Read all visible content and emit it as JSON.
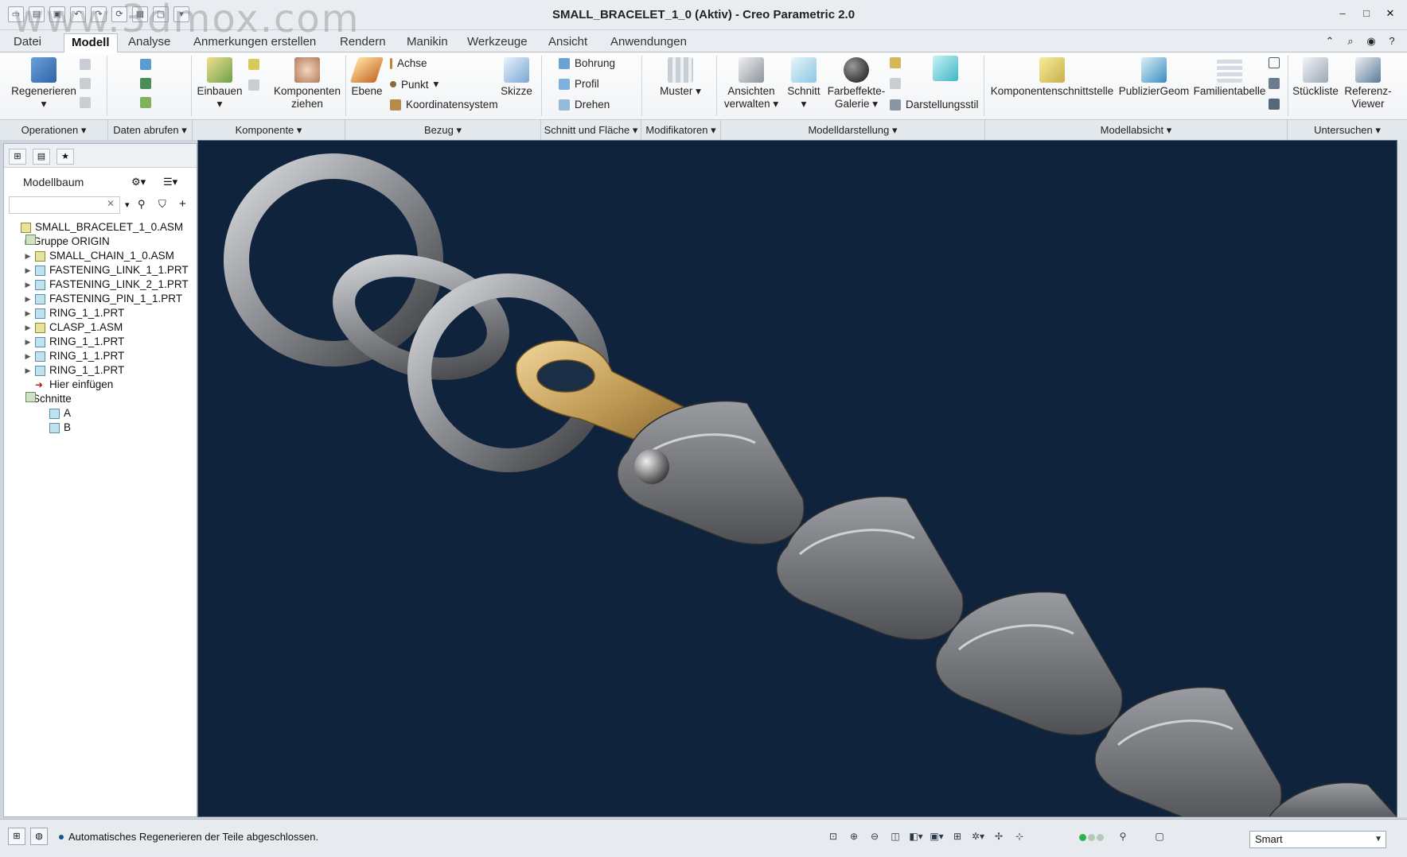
{
  "window": {
    "title": "SMALL_BRACELET_1_0 (Aktiv) - Creo Parametric 2.0",
    "watermark": "www.3dmox.com"
  },
  "tabs": [
    {
      "label": "Datei",
      "active": false
    },
    {
      "label": "Modell",
      "active": true
    },
    {
      "label": "Analyse",
      "active": false
    },
    {
      "label": "Anmerkungen erstellen",
      "active": false
    },
    {
      "label": "Rendern",
      "active": false
    },
    {
      "label": "Manikin",
      "active": false
    },
    {
      "label": "Werkzeuge",
      "active": false
    },
    {
      "label": "Ansicht",
      "active": false
    },
    {
      "label": "Anwendungen",
      "active": false
    }
  ],
  "ribbon": {
    "regenerieren": "Regenerieren",
    "einbauen": "Einbauen",
    "komponenten_ziehen_1": "Komponenten",
    "komponenten_ziehen_2": "ziehen",
    "ebene": "Ebene",
    "achse": "Achse",
    "punkt": "Punkt",
    "koordinatensystem": "Koordinatensystem",
    "skizze": "Skizze",
    "bohrung": "Bohrung",
    "profil": "Profil",
    "drehen": "Drehen",
    "muster": "Muster",
    "ansichten_verwalten_1": "Ansichten",
    "ansichten_verwalten_2": "verwalten",
    "schnitt": "Schnitt",
    "farbeffekte_1": "Farbeffekte-",
    "farbeffekte_2": "Galerie",
    "darstellungsstil": "Darstellungsstil",
    "komponentenschnittstelle": "Komponentenschnittstelle",
    "publiziergeom": "PublizierGeom",
    "familientabelle": "Familientabelle",
    "stueckliste": "Stückliste",
    "referenz_viewer_1": "Referenz-",
    "referenz_viewer_2": "Viewer"
  },
  "groups": [
    "Operationen",
    "Daten abrufen",
    "Komponente",
    "Bezug",
    "Schnitt und Fläche",
    "Modifikatoren",
    "Modelldarstellung",
    "Modellabsicht",
    "Untersuchen"
  ],
  "panel": {
    "title": "Modellbaum",
    "tree": [
      {
        "label": "SMALL_BRACELET_1_0.ASM",
        "kind": "asm",
        "level": 0,
        "expander": ""
      },
      {
        "label": "Gruppe ORIGIN",
        "kind": "grp",
        "level": 1,
        "expander": "▶"
      },
      {
        "label": "SMALL_CHAIN_1_0.ASM",
        "kind": "asm",
        "level": 1,
        "expander": "▶"
      },
      {
        "label": "FASTENING_LINK_1_1.PRT",
        "kind": "prt",
        "level": 1,
        "expander": "▶"
      },
      {
        "label": "FASTENING_LINK_2_1.PRT",
        "kind": "prt",
        "level": 1,
        "expander": "▶"
      },
      {
        "label": "FASTENING_PIN_1_1.PRT",
        "kind": "prt",
        "level": 1,
        "expander": "▶"
      },
      {
        "label": "RING_1_1.PRT",
        "kind": "prt",
        "level": 1,
        "expander": "▶"
      },
      {
        "label": "CLASP_1.ASM",
        "kind": "asm",
        "level": 1,
        "expander": "▶"
      },
      {
        "label": "RING_1_1.PRT",
        "kind": "prt",
        "level": 1,
        "expander": "▶"
      },
      {
        "label": "RING_1_1.PRT",
        "kind": "prt",
        "level": 1,
        "expander": "▶"
      },
      {
        "label": "RING_1_1.PRT",
        "kind": "prt",
        "level": 1,
        "expander": "▶"
      },
      {
        "label": "Hier einfügen",
        "kind": "ins",
        "level": 1,
        "expander": ""
      },
      {
        "label": "Schnitte",
        "kind": "grp",
        "level": 1,
        "expander": "▼"
      },
      {
        "label": "A",
        "kind": "prt",
        "level": 2,
        "expander": ""
      },
      {
        "label": "B",
        "kind": "prt",
        "level": 2,
        "expander": ""
      }
    ]
  },
  "status": {
    "message": "Automatisches Regenerieren der Teile abgeschlossen.",
    "selection_filter": "Smart"
  },
  "colors": {
    "viewport_bg": "#10233c",
    "chain_metal": "#8f9196",
    "clasp_gold": "#c09a55",
    "clasp_body": "#6e7074"
  }
}
